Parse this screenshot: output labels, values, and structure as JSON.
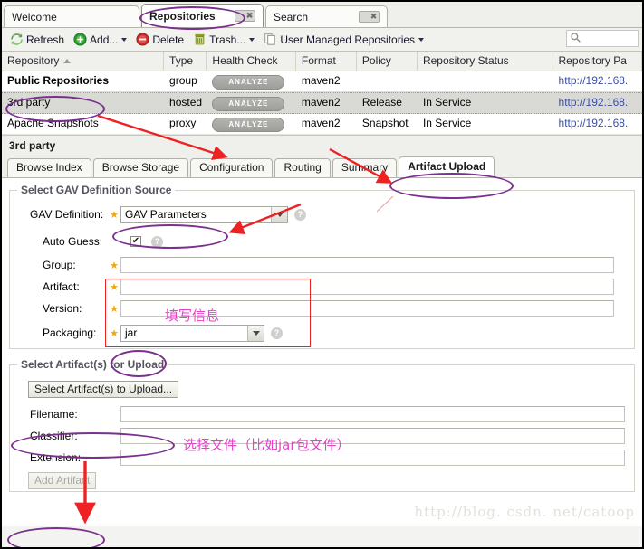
{
  "tabs": [
    {
      "label": "Welcome",
      "closable": false,
      "active": false
    },
    {
      "label": "Repositories",
      "closable": true,
      "active": true
    },
    {
      "label": "Search",
      "closable": true,
      "active": false
    }
  ],
  "close_glyph": "✖",
  "toolbar": {
    "buttons": [
      {
        "label": "Refresh",
        "icon": "refresh-icon",
        "caret": false
      },
      {
        "label": "Add...",
        "icon": "add-icon",
        "caret": true
      },
      {
        "label": "Delete",
        "icon": "delete-icon",
        "caret": false
      },
      {
        "label": "Trash...",
        "icon": "trash-icon",
        "caret": true
      },
      {
        "label": "User Managed Repositories",
        "icon": "copy-icon",
        "caret": true
      }
    ],
    "search_placeholder": "",
    "search_value": "",
    "search_icon": "search-icon"
  },
  "grid": {
    "columns": [
      {
        "key": "repository",
        "label": "Repository",
        "sorted": true
      },
      {
        "key": "type",
        "label": "Type"
      },
      {
        "key": "health",
        "label": "Health Check"
      },
      {
        "key": "format",
        "label": "Format"
      },
      {
        "key": "policy",
        "label": "Policy"
      },
      {
        "key": "status",
        "label": "Repository Status"
      },
      {
        "key": "path",
        "label": "Repository Pa"
      }
    ],
    "analyze_label": "ANALYZE",
    "rows": [
      {
        "repository": "Public Repositories",
        "type": "group",
        "health": "ANALYZE",
        "format": "maven2",
        "policy": "",
        "status": "",
        "path": "http://192.168.",
        "selected": false,
        "bold": true
      },
      {
        "repository": "3rd party",
        "type": "hosted",
        "health": "ANALYZE",
        "format": "maven2",
        "policy": "Release",
        "status": "In Service",
        "path": "http://192.168.",
        "selected": true,
        "bold": false
      },
      {
        "repository": "Apache Snapshots",
        "type": "proxy",
        "health": "ANALYZE",
        "format": "maven2",
        "policy": "Snapshot",
        "status": "In Service",
        "path": "http://192.168.",
        "selected": false,
        "bold": false
      }
    ]
  },
  "detail": {
    "title": "3rd party",
    "subtabs": [
      {
        "label": "Browse Index",
        "active": false
      },
      {
        "label": "Browse Storage",
        "active": false
      },
      {
        "label": "Configuration",
        "active": false
      },
      {
        "label": "Routing",
        "active": false
      },
      {
        "label": "Summary",
        "active": false
      },
      {
        "label": "Artifact Upload",
        "active": true
      }
    ]
  },
  "gav_section": {
    "legend": "Select GAV Definition Source",
    "gav_definition_label": "GAV Definition:",
    "gav_definition_value": "GAV Parameters",
    "auto_guess_label": "Auto Guess:",
    "auto_guess_checked": true,
    "auto_guess_glyph": "✔",
    "fields": [
      {
        "label": "Group:",
        "value": "",
        "required": true
      },
      {
        "label": "Artifact:",
        "value": "",
        "required": true
      },
      {
        "label": "Version:",
        "value": "",
        "required": true
      }
    ],
    "packaging_label": "Packaging:",
    "packaging_value": "jar",
    "help_glyph": "?",
    "star_glyph": "★"
  },
  "artifact_section": {
    "legend": "Select Artifact(s) for Upload",
    "select_button": "Select Artifact(s) to Upload...",
    "fields": [
      {
        "label": "Filename:",
        "value": ""
      },
      {
        "label": "Classifier:",
        "value": ""
      },
      {
        "label": "Extension:",
        "value": ""
      }
    ],
    "add_button": "Add Artifact"
  },
  "annotations": {
    "note_fill_info": "填写信息",
    "note_select_file": "选择文件（比如jar包文件）",
    "watermark": "http://blog. csdn. net/catoop",
    "accent_ellipse": "#7b2f8e",
    "accent_red": "#ee2222",
    "accent_pink": "#e642c8"
  }
}
